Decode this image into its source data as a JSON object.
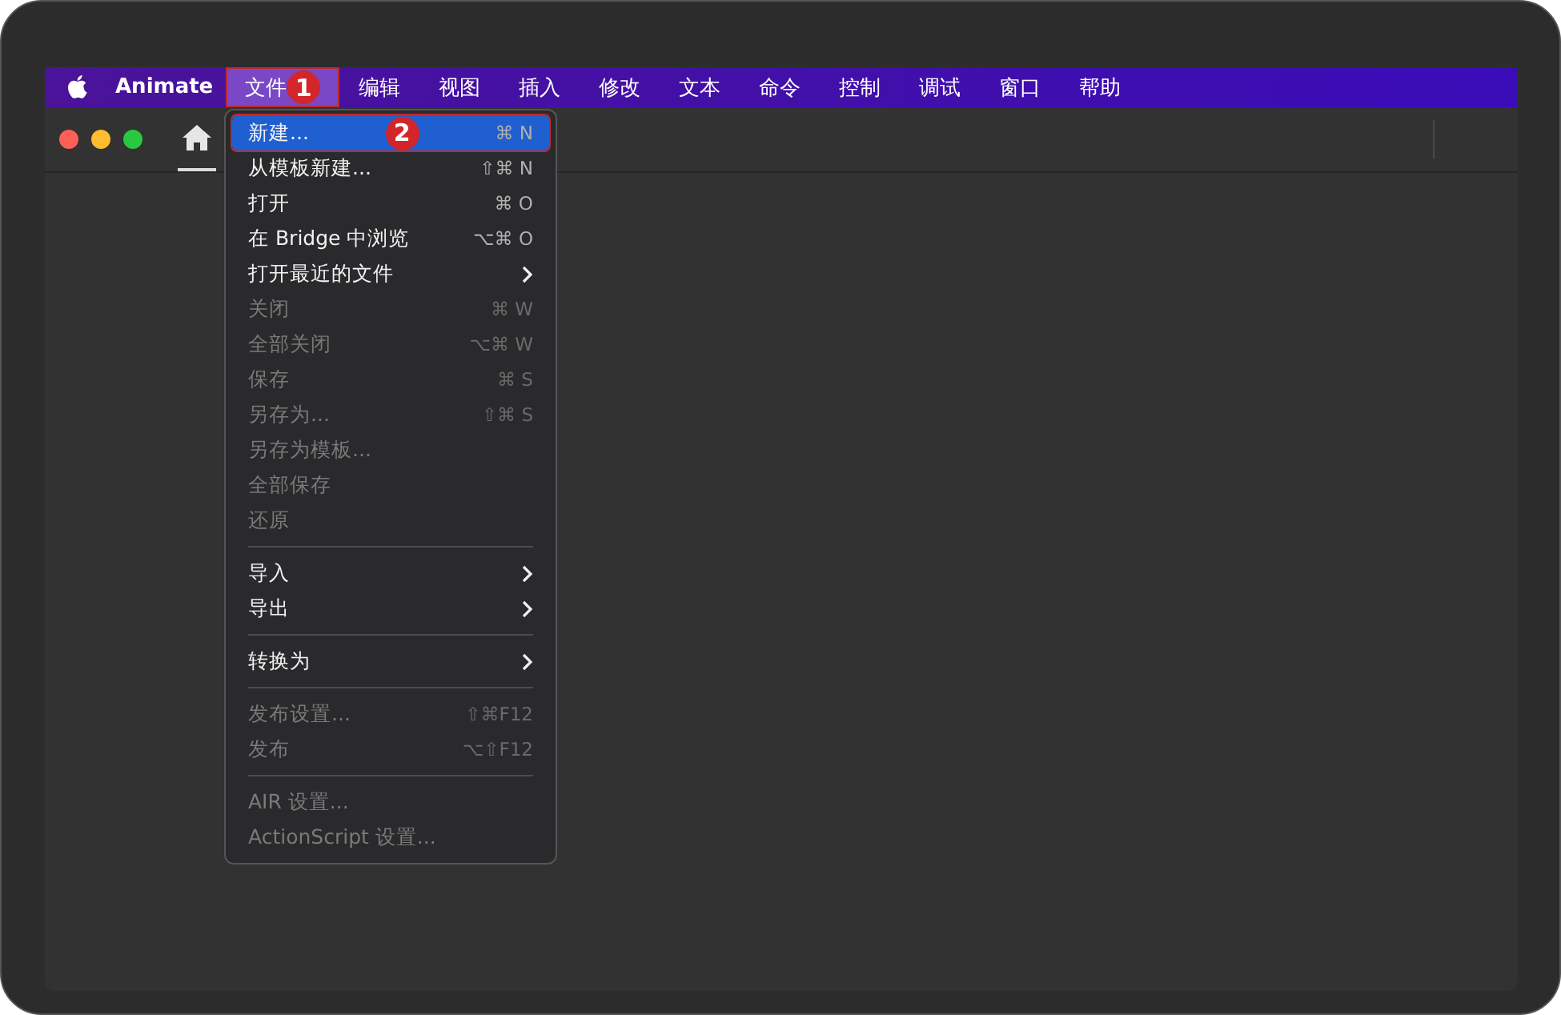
{
  "menubar": {
    "app_name": "Animate",
    "items": [
      {
        "label": "文件",
        "selected": true,
        "callout": "1"
      },
      {
        "label": "编辑",
        "selected": false
      },
      {
        "label": "视图",
        "selected": false
      },
      {
        "label": "插入",
        "selected": false
      },
      {
        "label": "修改",
        "selected": false
      },
      {
        "label": "文本",
        "selected": false
      },
      {
        "label": "命令",
        "selected": false
      },
      {
        "label": "控制",
        "selected": false
      },
      {
        "label": "调试",
        "selected": false
      },
      {
        "label": "窗口",
        "selected": false
      },
      {
        "label": "帮助",
        "selected": false
      }
    ]
  },
  "file_menu": [
    {
      "kind": "item",
      "label": "新建...",
      "shortcut": "⌘ N",
      "disabled": false,
      "selected": true,
      "callout": "2"
    },
    {
      "kind": "item",
      "label": "从模板新建...",
      "shortcut": "⇧⌘ N",
      "disabled": false,
      "selected": false
    },
    {
      "kind": "item",
      "label": "打开",
      "shortcut": "⌘ O",
      "disabled": false,
      "selected": false
    },
    {
      "kind": "item",
      "label": "在 Bridge 中浏览",
      "shortcut": "⌥⌘ O",
      "disabled": false,
      "selected": false
    },
    {
      "kind": "submenu",
      "label": "打开最近的文件",
      "disabled": false,
      "selected": false
    },
    {
      "kind": "item",
      "label": "关闭",
      "shortcut": "⌘ W",
      "disabled": true,
      "selected": false
    },
    {
      "kind": "item",
      "label": "全部关闭",
      "shortcut": "⌥⌘ W",
      "disabled": true,
      "selected": false
    },
    {
      "kind": "item",
      "label": "保存",
      "shortcut": "⌘ S",
      "disabled": true,
      "selected": false
    },
    {
      "kind": "item",
      "label": "另存为...",
      "shortcut": "⇧⌘ S",
      "disabled": true,
      "selected": false
    },
    {
      "kind": "item",
      "label": "另存为模板...",
      "disabled": true,
      "selected": false
    },
    {
      "kind": "item",
      "label": "全部保存",
      "disabled": true,
      "selected": false
    },
    {
      "kind": "item",
      "label": "还原",
      "disabled": true,
      "selected": false
    },
    {
      "kind": "separator"
    },
    {
      "kind": "submenu",
      "label": "导入",
      "disabled": false,
      "selected": false
    },
    {
      "kind": "submenu",
      "label": "导出",
      "disabled": false,
      "selected": false
    },
    {
      "kind": "separator"
    },
    {
      "kind": "submenu",
      "label": "转换为",
      "disabled": false,
      "selected": false
    },
    {
      "kind": "separator"
    },
    {
      "kind": "item",
      "label": "发布设置...",
      "shortcut": "⇧⌘F12",
      "disabled": true,
      "selected": false
    },
    {
      "kind": "item",
      "label": "发布",
      "shortcut": "⌥⇧F12",
      "disabled": true,
      "selected": false
    },
    {
      "kind": "separator"
    },
    {
      "kind": "item",
      "label": "AIR 设置...",
      "disabled": true,
      "selected": false
    },
    {
      "kind": "item",
      "label": "ActionScript 设置...",
      "disabled": true,
      "selected": false
    }
  ]
}
